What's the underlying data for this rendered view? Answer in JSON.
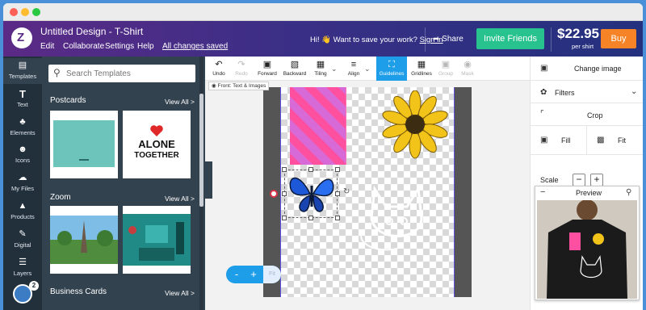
{
  "header": {
    "doc_title": "Untitled Design - T-Shirt",
    "menu": [
      "Edit",
      "Collaborate",
      "Settings",
      "Help"
    ],
    "saved_status": "All changes saved",
    "save_prompt": "Hi! 👋 Want to save your work?",
    "signin_link": "Sign in",
    "share_label": "Share",
    "invite_label": "Invite Friends",
    "price": "$22.95",
    "price_unit": "per shirt",
    "buy_label": "Buy"
  },
  "leftnav": {
    "items": [
      {
        "label": "Templates",
        "icon": "templates-icon"
      },
      {
        "label": "Text",
        "icon": "text-icon"
      },
      {
        "label": "Elements",
        "icon": "elements-icon"
      },
      {
        "label": "Icons",
        "icon": "icons-icon"
      },
      {
        "label": "My Files",
        "icon": "upload-icon"
      },
      {
        "label": "Products",
        "icon": "tshirt-icon"
      },
      {
        "label": "Digital",
        "icon": "pen-icon"
      },
      {
        "label": "Layers",
        "icon": "layers-icon"
      }
    ],
    "badge": "2"
  },
  "templates": {
    "search_placeholder": "Search Templates",
    "view_all": "View All >",
    "sections": [
      {
        "title": "Postcards"
      },
      {
        "title": "Zoom"
      },
      {
        "title": "Business Cards"
      }
    ],
    "alone_line1": "ALONE",
    "alone_line2": "TOGETHER"
  },
  "toolbar": {
    "tools": [
      {
        "label": "Undo",
        "state": "enabled"
      },
      {
        "label": "Redo",
        "state": "disabled"
      },
      {
        "label": "Forward",
        "state": "enabled"
      },
      {
        "label": "Backward",
        "state": "enabled"
      },
      {
        "label": "Tiling",
        "state": "enabled"
      },
      {
        "label": "Align",
        "state": "enabled"
      },
      {
        "label": "Guidelines",
        "state": "active"
      },
      {
        "label": "Gridlines",
        "state": "enabled"
      },
      {
        "label": "Group",
        "state": "disabled"
      },
      {
        "label": "Mask",
        "state": "disabled"
      }
    ]
  },
  "canvas": {
    "view_label": "Front: Text & Images",
    "zoom_minus": "-",
    "zoom_plus": "+",
    "zoom_fit": "Fit"
  },
  "rightpanel": {
    "change_image": "Change image",
    "filters": "Filters",
    "crop": "Crop",
    "fill": "Fill",
    "fit": "Fit",
    "scale_label": "Scale",
    "scale_minus": "−",
    "scale_plus": "+"
  },
  "preview": {
    "title": "Preview",
    "collapse": "−",
    "dot_count": 8
  },
  "colors": {
    "header_start": "#5b2a86",
    "invite": "#27c28d",
    "buy": "#f68427",
    "active_tool": "#1e9ee9",
    "nav_bg": "#22303c"
  }
}
